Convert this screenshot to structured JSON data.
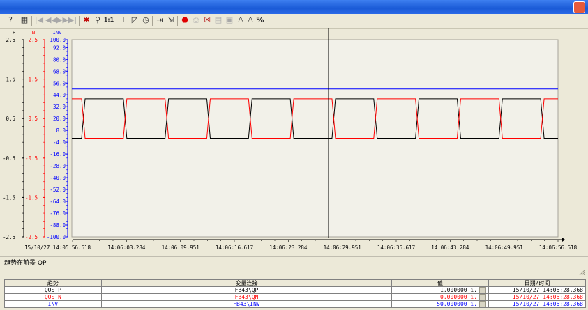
{
  "status": {
    "text": "趋势在前景 QP"
  },
  "axes": {
    "p": {
      "header": "P",
      "color": "#000000",
      "ticks": [
        "2.5",
        "1.5",
        "0.5",
        "-0.5",
        "-1.5",
        "-2.5"
      ]
    },
    "n": {
      "header": "N",
      "color": "#ff0000",
      "ticks": [
        "2.5",
        "1.5",
        "0.5",
        "-0.5",
        "-1.5",
        "-2.5"
      ]
    },
    "inv": {
      "header": "INV",
      "color": "#0000ff",
      "ticks": [
        "100.0",
        "92.0",
        "80.0",
        "68.0",
        "56.0",
        "44.0",
        "32.0",
        "20.0",
        "8.0",
        "-4.0",
        "-16.0",
        "-28.0",
        "-40.0",
        "-52.0",
        "-64.0",
        "-76.0",
        "-88.0",
        "-100.0"
      ]
    }
  },
  "time_axis": {
    "labels": [
      "15/10/27 14:05:56.618",
      "14:06:03.284",
      "14:06:09.951",
      "14:06:16.617",
      "14:06:23.284",
      "14:06:29.951",
      "14:06:36.617",
      "14:06:43.284",
      "14:06:49.951",
      "14:06:56.618"
    ]
  },
  "chart_data": {
    "type": "line",
    "x_range": [
      "15/10/27 14:05:56.618",
      "14:06:56.618"
    ],
    "cursor_time": "14:06:28.368",
    "grid": false,
    "axes": [
      {
        "name": "P",
        "ylim": [
          -2.5,
          2.5
        ]
      },
      {
        "name": "N",
        "ylim": [
          -2.5,
          2.5
        ]
      },
      {
        "name": "INV",
        "ylim": [
          -100,
          100
        ]
      }
    ],
    "series": [
      {
        "name": "QOS_P",
        "axis": "P",
        "color": "#000000",
        "waveform": "square",
        "high": 1,
        "low": 0,
        "period_s": 10.3,
        "start_level": 0
      },
      {
        "name": "QOS_N",
        "axis": "N",
        "color": "#ff0000",
        "waveform": "square",
        "high": 1,
        "low": 0,
        "period_s": 10.3,
        "start_level": 1
      },
      {
        "name": "INV",
        "axis": "INV",
        "color": "#0000ff",
        "waveform": "constant",
        "value": 50
      }
    ]
  },
  "table": {
    "headers": [
      "趋势",
      "变量连接",
      "值",
      "日期/时间"
    ],
    "rows": [
      {
        "trend": "QOS_P",
        "link": "FB43\\QP",
        "value": "1.000000 i.",
        "datetime": "15/10/27 14:06:28.368",
        "color": "#000000"
      },
      {
        "trend": "QOS_N",
        "link": "FB43\\QN",
        "value": "0.000000 i.",
        "datetime": "15/10/27 14:06:28.368",
        "color": "#ff0000"
      },
      {
        "trend": "INV",
        "link": "FB43\\INV",
        "value": "50.000000 i.",
        "datetime": "15/10/27 14:06:28.368",
        "color": "#0000ff"
      }
    ]
  },
  "toolbar": {
    "icons": [
      "help-icon",
      "screen-icon",
      "first-icon",
      "prev-icon",
      "next-icon",
      "last-icon",
      "pause-trend-icon",
      "zoom-icon",
      "original-size-icon",
      "ruler-icon",
      "area-zoom-icon",
      "timer-icon",
      "move-axis-icon",
      "move-area-icon",
      "stop-icon",
      "print-icon",
      "config-icon",
      "export-icon",
      "save-icon",
      "select-trend-icon",
      "select-data-icon",
      "percent-icon"
    ],
    "one_to_one_label": "1:1",
    "percent_label": "%"
  }
}
